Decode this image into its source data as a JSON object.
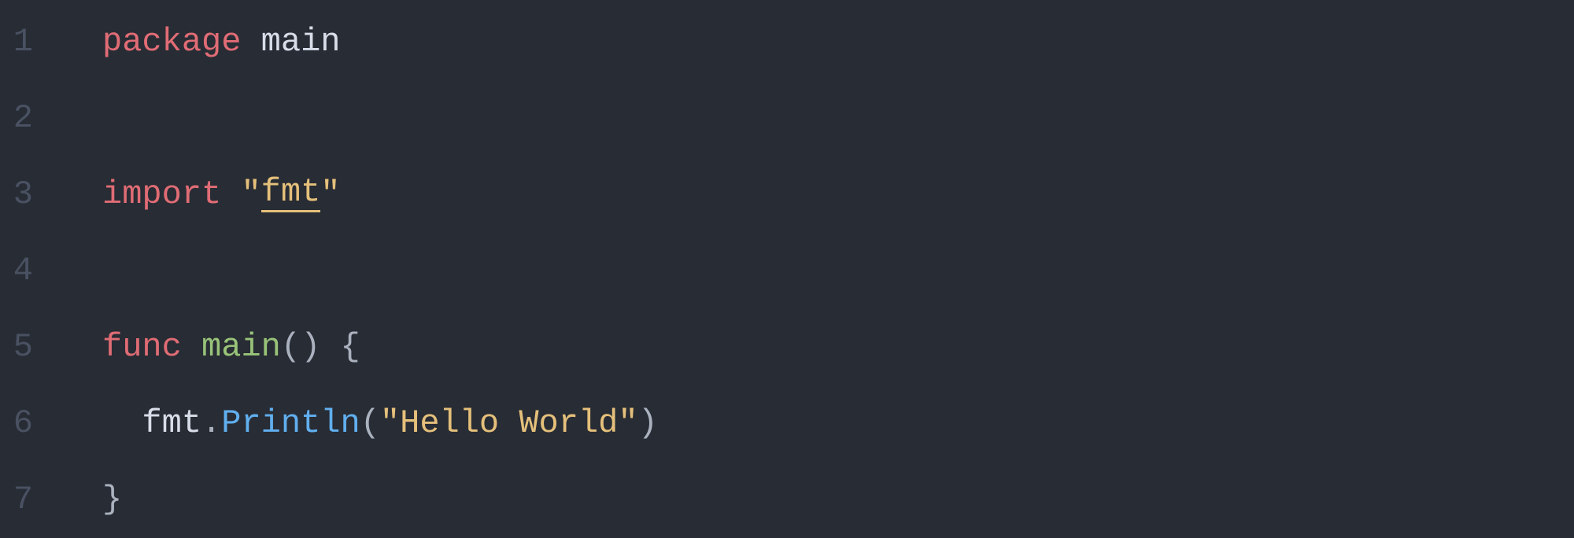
{
  "lines": [
    {
      "num": "1"
    },
    {
      "num": "2"
    },
    {
      "num": "3"
    },
    {
      "num": "4"
    },
    {
      "num": "5"
    },
    {
      "num": "6"
    },
    {
      "num": "7"
    }
  ],
  "code": {
    "line1": {
      "package_kw": "package",
      "space": " ",
      "main": "main"
    },
    "line3": {
      "import_kw": "import",
      "space": " ",
      "quote1": "\"",
      "fmt": "fmt",
      "quote2": "\""
    },
    "line5": {
      "func_kw": "func",
      "space": " ",
      "main_fn": "main",
      "parens": "()",
      "space2": " ",
      "brace": "{"
    },
    "line6": {
      "fmt": "fmt",
      "dot": ".",
      "println": "Println",
      "lparen": "(",
      "str": "\"Hello World\"",
      "rparen": ")"
    },
    "line7": {
      "brace": "}"
    }
  }
}
